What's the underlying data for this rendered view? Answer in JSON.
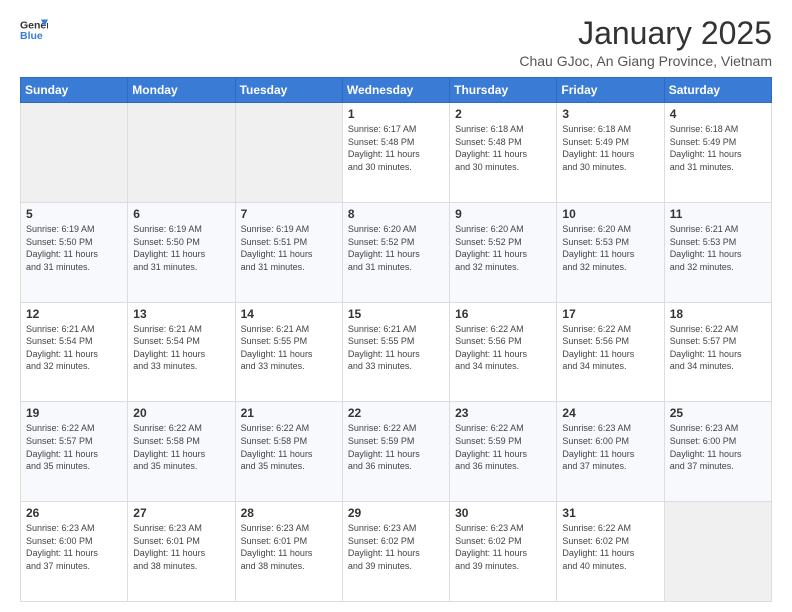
{
  "header": {
    "logo_line1": "General",
    "logo_line2": "Blue",
    "title": "January 2025",
    "subtitle": "Chau GJoc, An Giang Province, Vietnam"
  },
  "days_of_week": [
    "Sunday",
    "Monday",
    "Tuesday",
    "Wednesday",
    "Thursday",
    "Friday",
    "Saturday"
  ],
  "weeks": [
    [
      {
        "day": "",
        "info": ""
      },
      {
        "day": "",
        "info": ""
      },
      {
        "day": "",
        "info": ""
      },
      {
        "day": "1",
        "info": "Sunrise: 6:17 AM\nSunset: 5:48 PM\nDaylight: 11 hours\nand 30 minutes."
      },
      {
        "day": "2",
        "info": "Sunrise: 6:18 AM\nSunset: 5:48 PM\nDaylight: 11 hours\nand 30 minutes."
      },
      {
        "day": "3",
        "info": "Sunrise: 6:18 AM\nSunset: 5:49 PM\nDaylight: 11 hours\nand 30 minutes."
      },
      {
        "day": "4",
        "info": "Sunrise: 6:18 AM\nSunset: 5:49 PM\nDaylight: 11 hours\nand 31 minutes."
      }
    ],
    [
      {
        "day": "5",
        "info": "Sunrise: 6:19 AM\nSunset: 5:50 PM\nDaylight: 11 hours\nand 31 minutes."
      },
      {
        "day": "6",
        "info": "Sunrise: 6:19 AM\nSunset: 5:50 PM\nDaylight: 11 hours\nand 31 minutes."
      },
      {
        "day": "7",
        "info": "Sunrise: 6:19 AM\nSunset: 5:51 PM\nDaylight: 11 hours\nand 31 minutes."
      },
      {
        "day": "8",
        "info": "Sunrise: 6:20 AM\nSunset: 5:52 PM\nDaylight: 11 hours\nand 31 minutes."
      },
      {
        "day": "9",
        "info": "Sunrise: 6:20 AM\nSunset: 5:52 PM\nDaylight: 11 hours\nand 32 minutes."
      },
      {
        "day": "10",
        "info": "Sunrise: 6:20 AM\nSunset: 5:53 PM\nDaylight: 11 hours\nand 32 minutes."
      },
      {
        "day": "11",
        "info": "Sunrise: 6:21 AM\nSunset: 5:53 PM\nDaylight: 11 hours\nand 32 minutes."
      }
    ],
    [
      {
        "day": "12",
        "info": "Sunrise: 6:21 AM\nSunset: 5:54 PM\nDaylight: 11 hours\nand 32 minutes."
      },
      {
        "day": "13",
        "info": "Sunrise: 6:21 AM\nSunset: 5:54 PM\nDaylight: 11 hours\nand 33 minutes."
      },
      {
        "day": "14",
        "info": "Sunrise: 6:21 AM\nSunset: 5:55 PM\nDaylight: 11 hours\nand 33 minutes."
      },
      {
        "day": "15",
        "info": "Sunrise: 6:21 AM\nSunset: 5:55 PM\nDaylight: 11 hours\nand 33 minutes."
      },
      {
        "day": "16",
        "info": "Sunrise: 6:22 AM\nSunset: 5:56 PM\nDaylight: 11 hours\nand 34 minutes."
      },
      {
        "day": "17",
        "info": "Sunrise: 6:22 AM\nSunset: 5:56 PM\nDaylight: 11 hours\nand 34 minutes."
      },
      {
        "day": "18",
        "info": "Sunrise: 6:22 AM\nSunset: 5:57 PM\nDaylight: 11 hours\nand 34 minutes."
      }
    ],
    [
      {
        "day": "19",
        "info": "Sunrise: 6:22 AM\nSunset: 5:57 PM\nDaylight: 11 hours\nand 35 minutes."
      },
      {
        "day": "20",
        "info": "Sunrise: 6:22 AM\nSunset: 5:58 PM\nDaylight: 11 hours\nand 35 minutes."
      },
      {
        "day": "21",
        "info": "Sunrise: 6:22 AM\nSunset: 5:58 PM\nDaylight: 11 hours\nand 35 minutes."
      },
      {
        "day": "22",
        "info": "Sunrise: 6:22 AM\nSunset: 5:59 PM\nDaylight: 11 hours\nand 36 minutes."
      },
      {
        "day": "23",
        "info": "Sunrise: 6:22 AM\nSunset: 5:59 PM\nDaylight: 11 hours\nand 36 minutes."
      },
      {
        "day": "24",
        "info": "Sunrise: 6:23 AM\nSunset: 6:00 PM\nDaylight: 11 hours\nand 37 minutes."
      },
      {
        "day": "25",
        "info": "Sunrise: 6:23 AM\nSunset: 6:00 PM\nDaylight: 11 hours\nand 37 minutes."
      }
    ],
    [
      {
        "day": "26",
        "info": "Sunrise: 6:23 AM\nSunset: 6:00 PM\nDaylight: 11 hours\nand 37 minutes."
      },
      {
        "day": "27",
        "info": "Sunrise: 6:23 AM\nSunset: 6:01 PM\nDaylight: 11 hours\nand 38 minutes."
      },
      {
        "day": "28",
        "info": "Sunrise: 6:23 AM\nSunset: 6:01 PM\nDaylight: 11 hours\nand 38 minutes."
      },
      {
        "day": "29",
        "info": "Sunrise: 6:23 AM\nSunset: 6:02 PM\nDaylight: 11 hours\nand 39 minutes."
      },
      {
        "day": "30",
        "info": "Sunrise: 6:23 AM\nSunset: 6:02 PM\nDaylight: 11 hours\nand 39 minutes."
      },
      {
        "day": "31",
        "info": "Sunrise: 6:22 AM\nSunset: 6:02 PM\nDaylight: 11 hours\nand 40 minutes."
      },
      {
        "day": "",
        "info": ""
      }
    ]
  ]
}
